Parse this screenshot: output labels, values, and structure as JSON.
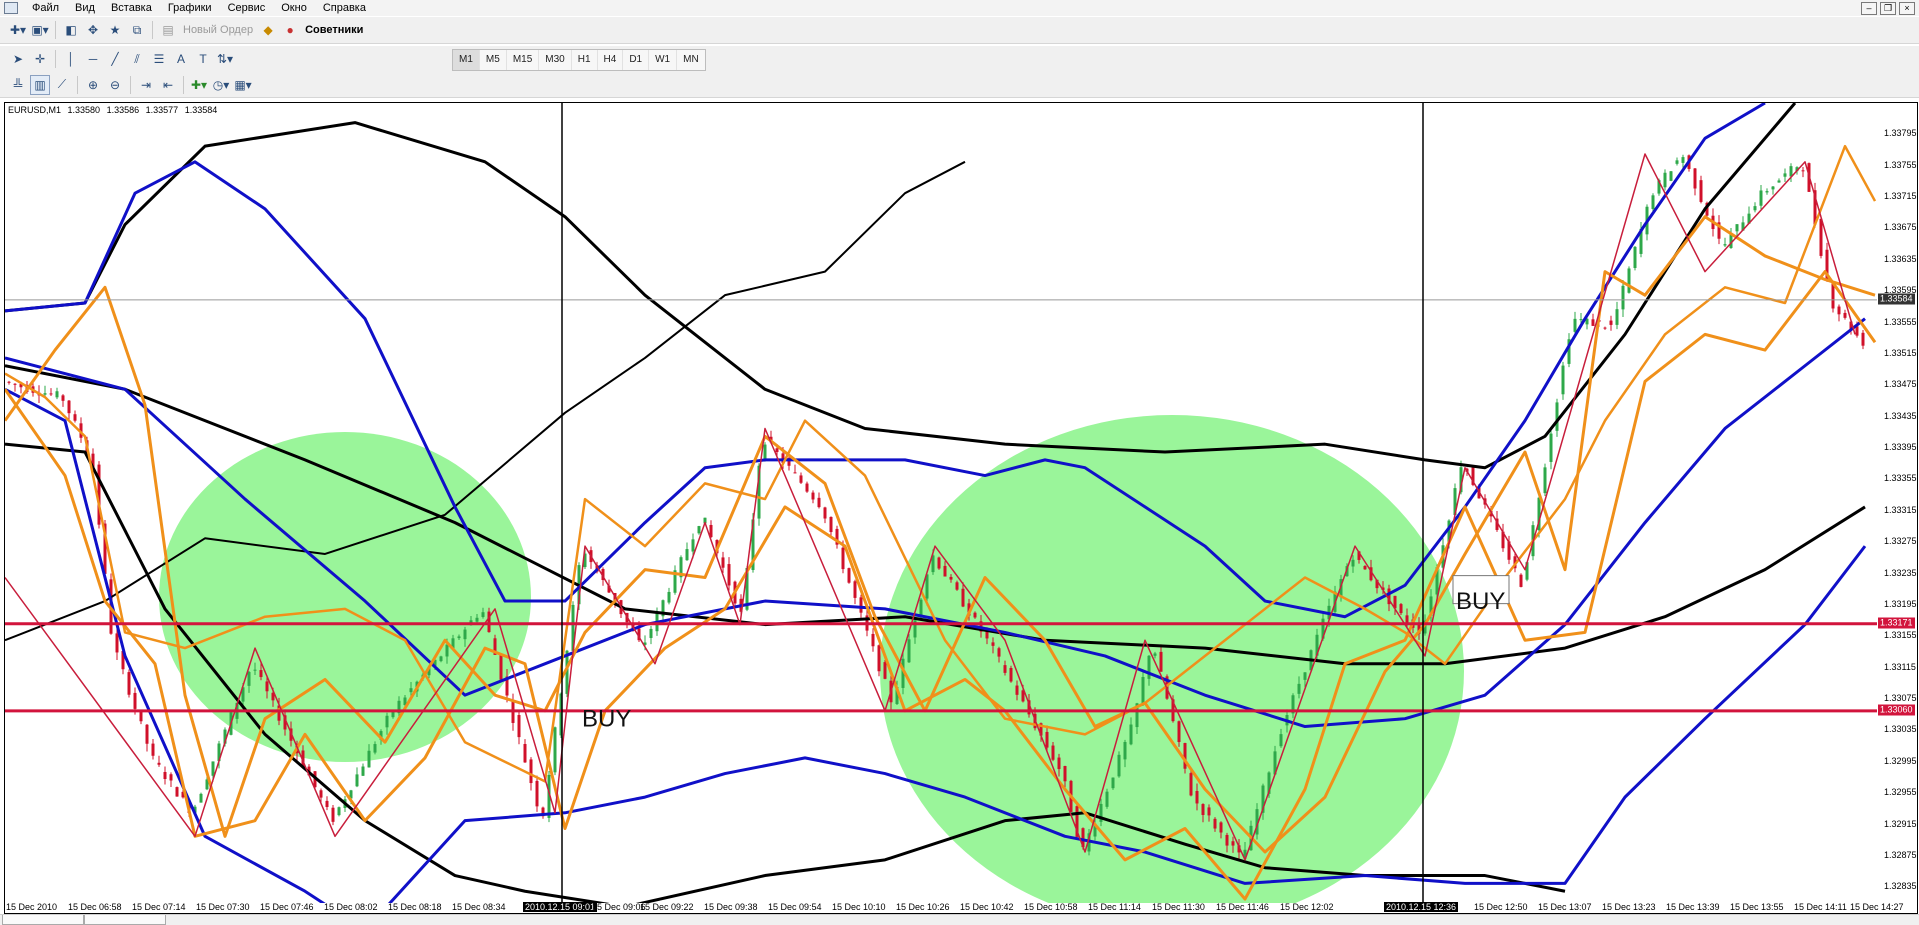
{
  "menu": {
    "items": [
      "Файл",
      "Вид",
      "Вставка",
      "Графики",
      "Сервис",
      "Окно",
      "Справка"
    ]
  },
  "toolbar": {
    "new_order_label": "Новый Ордер",
    "experts_label": "Советники",
    "timeframes": [
      "M1",
      "M5",
      "M15",
      "M30",
      "H1",
      "H4",
      "D1",
      "W1",
      "MN"
    ],
    "active_timeframe": "M1"
  },
  "chart": {
    "symbol": "EURUSD,M1",
    "ohlc": [
      "1.33580",
      "1.33586",
      "1.33577",
      "1.33584"
    ],
    "annotations": {
      "buy_label_1": "BUY",
      "buy_label_2": "BUY"
    },
    "colors": {
      "bands_blue": "#1010c8",
      "bands_black": "#000000",
      "envelope_orange": "#f0901a",
      "zigzag": "#c81e3c",
      "level_line": "#d2143c",
      "highlight_green": "#9af59a",
      "candle_green": "#2ea84a",
      "candle_red": "#d0102a"
    }
  },
  "price_scale": {
    "ticks": [
      "1.33795",
      "1.33755",
      "1.33715",
      "1.33675",
      "1.33635",
      "1.33595",
      "1.33555",
      "1.33515",
      "1.33475",
      "1.33435",
      "1.33395",
      "1.33355",
      "1.33315",
      "1.33275",
      "1.33235",
      "1.33195",
      "1.33155",
      "1.33115",
      "1.33075",
      "1.33035",
      "1.32995",
      "1.32955",
      "1.32915",
      "1.32875",
      "1.32835"
    ],
    "current_price": "1.33584",
    "level_1": "1.33171",
    "level_2": "1.33060"
  },
  "time_axis": {
    "labels": [
      "15 Dec 2010",
      "15 Dec 06:58",
      "15 Dec 07:14",
      "15 Dec 07:30",
      "15 Dec 07:46",
      "15 Dec 08:02",
      "15 Dec 08:18",
      "15 Dec 08:34",
      "2010.12.15 09:01",
      "15 Dec 09:06",
      "15 Dec 09:22",
      "15 Dec 09:38",
      "15 Dec 09:54",
      "15 Dec 10:10",
      "15 Dec 10:26",
      "15 Dec 10:42",
      "15 Dec 10:58",
      "15 Dec 11:14",
      "15 Dec 11:30",
      "15 Dec 11:46",
      "15 Dec 12:02",
      "2010.12.15 12:36",
      "15 Dec 12:50",
      "15 Dec 13:07",
      "15 Dec 13:23",
      "15 Dec 13:39",
      "15 Dec 13:55",
      "15 Dec 14:11",
      "15 Dec 14:27"
    ],
    "highlighted": [
      "2010.12.15 09:01",
      "2010.12.15 12:36"
    ]
  }
}
